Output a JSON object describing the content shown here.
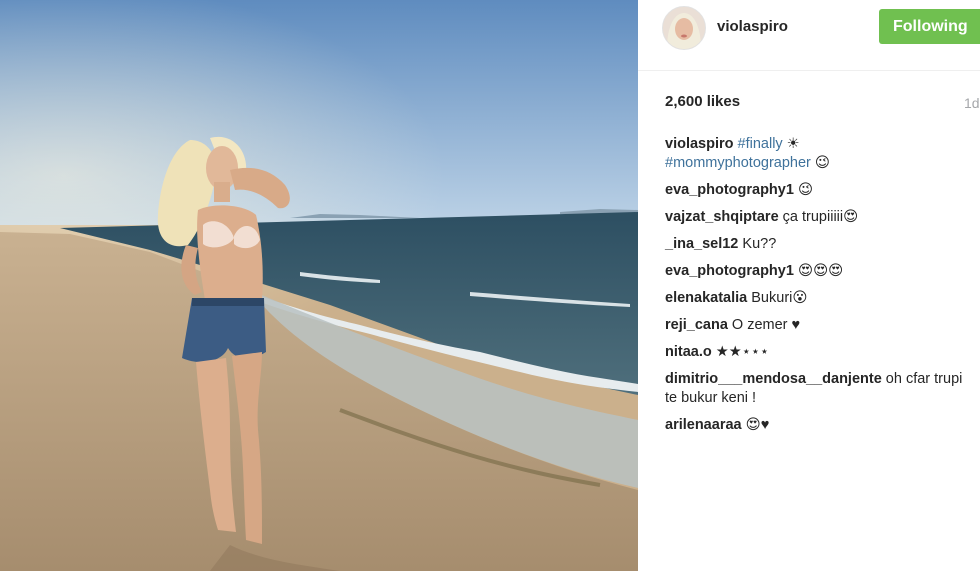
{
  "post": {
    "username": "violaspiro",
    "follow_label": "Following",
    "likes": "2,600 likes",
    "time": "1d"
  },
  "caption": {
    "user": "violaspiro",
    "tag1": "#finally",
    "emoji1": "☀",
    "tag2": "#mommyphotographer",
    "emoji2": "😉"
  },
  "comments": [
    {
      "user": "eva_photography1",
      "text": "😉"
    },
    {
      "user": "vajzat_shqiptare",
      "text": "ça trupiiiii😍"
    },
    {
      "user": "_ina_sel12",
      "text": "Ku??"
    },
    {
      "user": "eva_photography1",
      "text": "😍😍😍"
    },
    {
      "user": "elenakatalia",
      "text": "Bukuri😮"
    },
    {
      "user": "reji_cana",
      "text": "O zemer ♥"
    },
    {
      "user": "nitaa.o",
      "text": "★★⋆⋆⋆"
    },
    {
      "user": "dimitrio___mendosa__danjente",
      "text": "oh cfar trupi te bukur keni !"
    },
    {
      "user": "arilenaaraa",
      "text": "😍♥"
    }
  ],
  "colors": {
    "follow_button": "#70c050",
    "hashtag": "#3f729b",
    "timestamp": "#a5a7aa"
  },
  "icons": {
    "photo": "beach-photo"
  }
}
